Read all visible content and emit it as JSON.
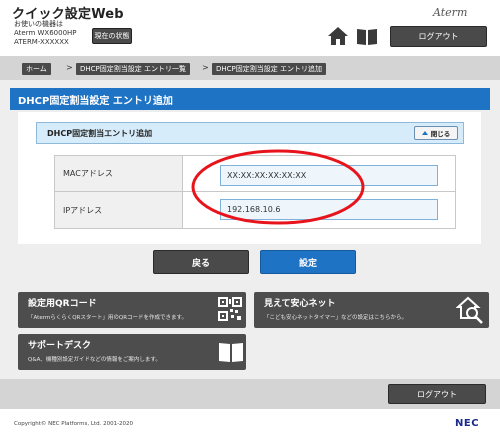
{
  "header": {
    "app_title": "クイック設定Web",
    "device_line1": "お使いの機器は",
    "device_line2": "Aterm WX6000HP",
    "device_line3": "ATERM-XXXXXX",
    "status_button": "現在の状態",
    "brand": "Aterm",
    "logout": "ログアウト"
  },
  "breadcrumb": {
    "home": "ホーム",
    "list": "DHCP固定割当設定 エントリ一覧",
    "current": "DHCP固定割当設定 エントリ追加",
    "separator": ">"
  },
  "page": {
    "title": "DHCP固定割当設定 エントリ追加",
    "section_title": "DHCP固定割当エントリ追加",
    "close_label": "閉じる"
  },
  "form": {
    "mac_label": "MACアドレス",
    "mac_value": "XX:XX:XX:XX:XX:XX",
    "ip_label": "IPアドレス",
    "ip_value": "192.168.10.6"
  },
  "actions": {
    "back": "戻る",
    "set": "設定"
  },
  "tiles": {
    "qr_title": "設定用QRコード",
    "qr_desc": "「AtermらくらくQRスタート」用のQRコードを作成できます。",
    "safety_title": "見えて安心ネット",
    "safety_desc": "「こども安心ネットタイマー」などの設定はこちらから。",
    "support_title": "サポートデスク",
    "support_desc": "Q&A、機種別設定ガイドなどの情報をご案内します。"
  },
  "footer": {
    "logout": "ログアウト",
    "copyright": "Copyright© NEC Platforms, Ltd. 2001-2020",
    "brand": "NEC"
  },
  "colors": {
    "accent_blue": "#1f73c4",
    "dark_button": "#4a4a4a",
    "highlight_red": "#e8141c"
  }
}
